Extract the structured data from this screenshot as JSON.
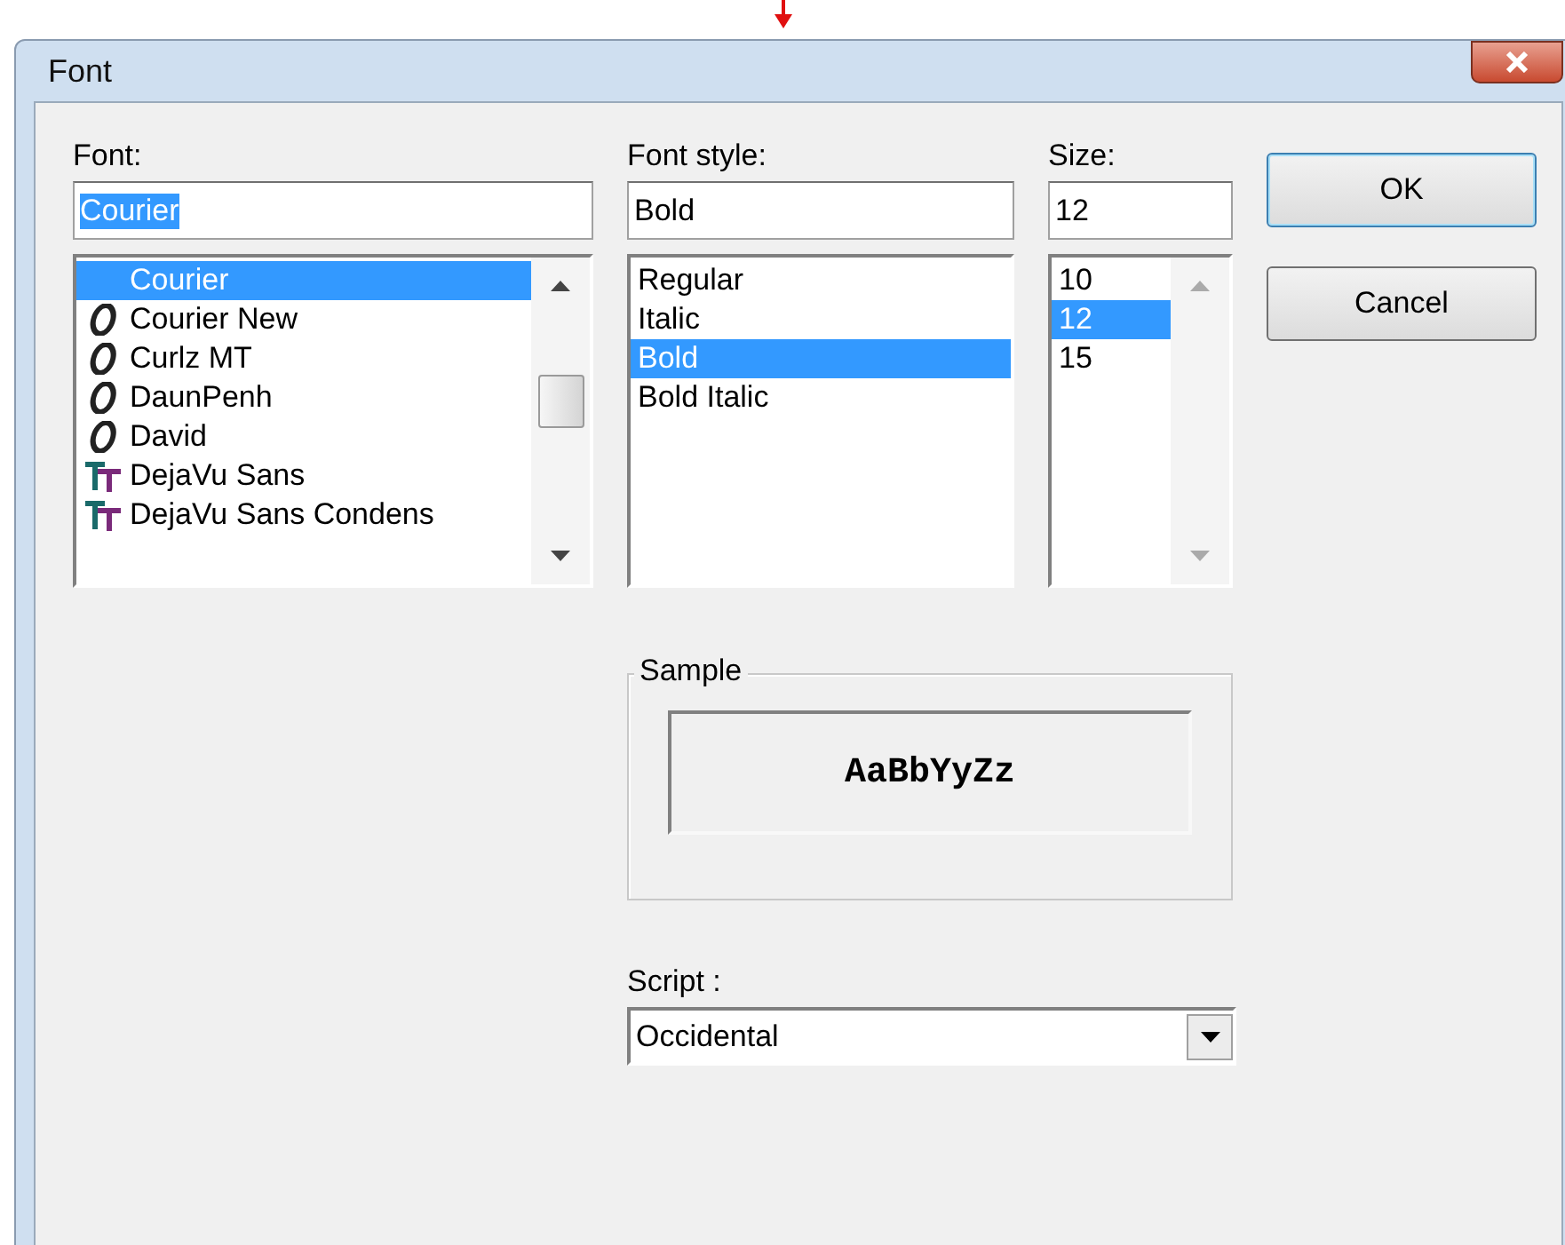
{
  "window": {
    "title": "Font"
  },
  "font": {
    "label": "Font:",
    "value": "Courier",
    "items": [
      {
        "name": "Courier",
        "kind": "plain",
        "selected": true
      },
      {
        "name": "Courier New",
        "kind": "opentype",
        "selected": false
      },
      {
        "name": "Curlz MT",
        "kind": "opentype",
        "selected": false
      },
      {
        "name": "DaunPenh",
        "kind": "opentype",
        "selected": false
      },
      {
        "name": "David",
        "kind": "opentype",
        "selected": false
      },
      {
        "name": "DejaVu Sans",
        "kind": "truetype",
        "selected": false
      },
      {
        "name": "DejaVu Sans Condens",
        "kind": "truetype",
        "selected": false
      }
    ]
  },
  "font_style": {
    "label": "Font style:",
    "value": "Bold",
    "items": [
      {
        "name": "Regular",
        "selected": false
      },
      {
        "name": "Italic",
        "selected": false
      },
      {
        "name": "Bold",
        "selected": true
      },
      {
        "name": "Bold Italic",
        "selected": false
      }
    ]
  },
  "size": {
    "label": "Size:",
    "value": "12",
    "items": [
      {
        "name": "10",
        "selected": false
      },
      {
        "name": "12",
        "selected": true
      },
      {
        "name": "15",
        "selected": false
      }
    ]
  },
  "buttons": [
    "OK",
    "Cancel"
  ],
  "sample": {
    "label": "Sample",
    "text": "AaBbYyZz"
  },
  "script": {
    "label": "Script :",
    "value": "Occidental"
  }
}
